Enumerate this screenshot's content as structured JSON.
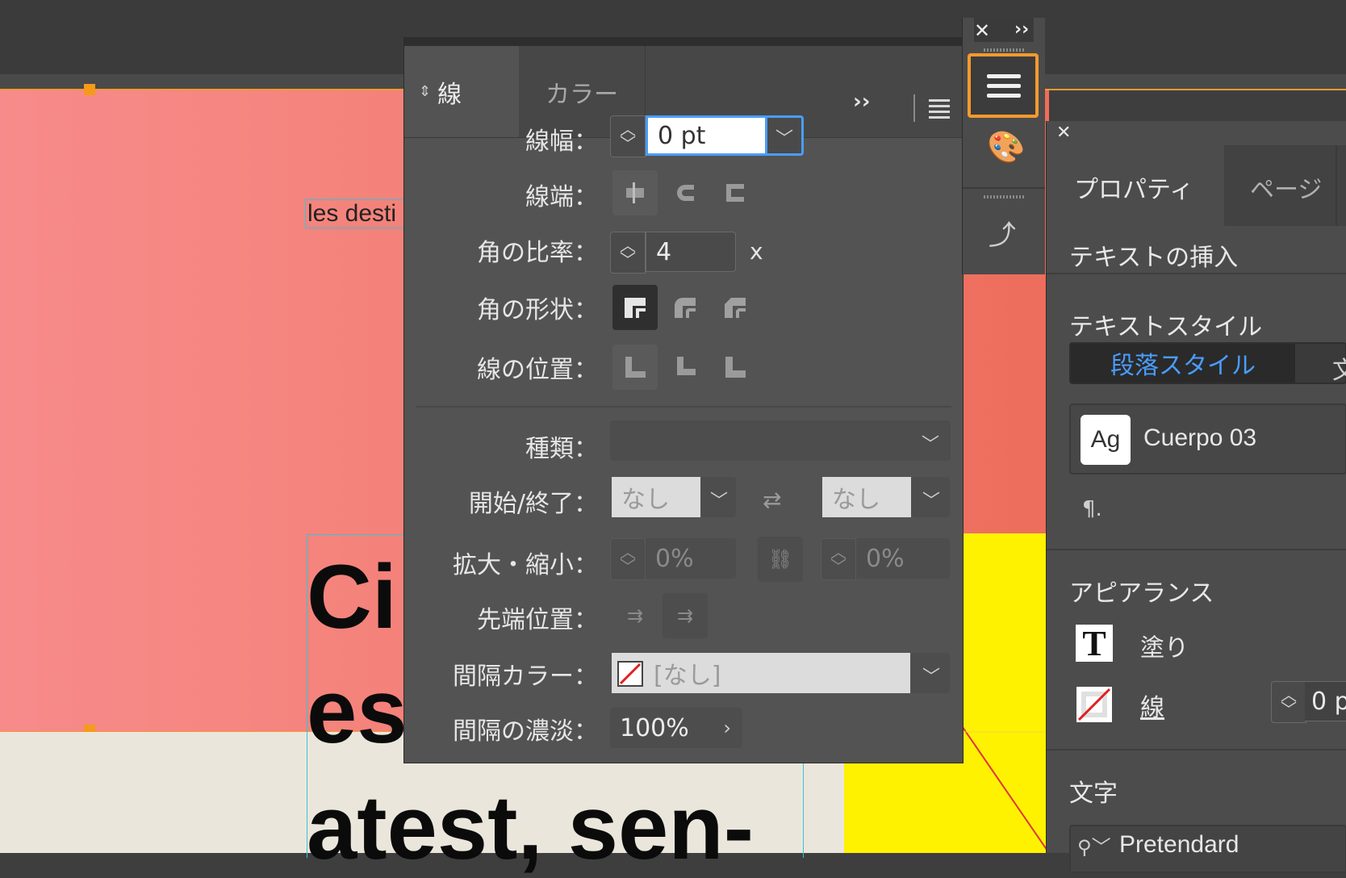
{
  "canvas": {
    "small_text": "les desti",
    "big_lines": [
      "Ci",
      "es",
      "atest, sen-"
    ]
  },
  "stroke_panel": {
    "tabs": {
      "stroke": "線",
      "color": "カラー"
    },
    "labels": {
      "weight": "線幅：",
      "cap": "線端：",
      "miter": "角の比率：",
      "join": "角の形状：",
      "align": "線の位置：",
      "type": "種類：",
      "start_end": "開始/終了：",
      "scale": "拡大・縮小：",
      "align_tip": "先端位置：",
      "gap_color": "間隔カラー：",
      "gap_tint": "間隔の濃淡："
    },
    "weight_value": "0 pt",
    "miter_value": "4",
    "miter_unit": "x",
    "start_value": "なし",
    "end_value": "なし",
    "scale_start": "0%",
    "scale_end": "0%",
    "gap_color_value": "[なし]",
    "gap_tint_value": "100%"
  },
  "properties_panel": {
    "tabs": [
      "プロパティ",
      "ページ"
    ],
    "insert_text": "テキストの挿入",
    "text_style_heading": "テキストスタイル",
    "paragraph_style_tab": "段落スタイル",
    "char_style_tab_partial": "文",
    "style_preview": "Ag",
    "style_name": "Cuerpo 03",
    "appearance_heading": "アピアランス",
    "fill_label": "塗り",
    "stroke_label": "線",
    "stroke_value_partial": "0 p",
    "character_heading": "文字",
    "font_name": "Pretendard"
  },
  "colors": {
    "accent_blue": "#4a9dfd",
    "dock_highlight": "#f29a2e"
  }
}
